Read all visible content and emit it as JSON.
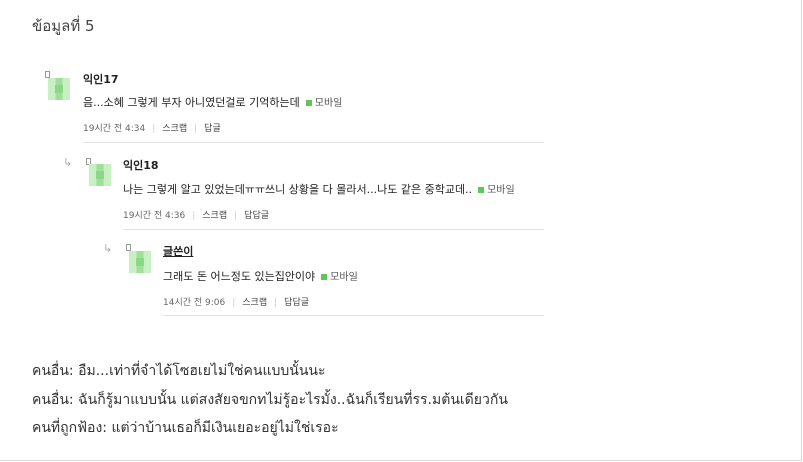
{
  "heading": "ข้อมูลที่ 5",
  "comments": [
    {
      "nick": "익인17",
      "text": "음...소혜 그렇게 부자 아니였던걸로 기억하는데",
      "device": "모바일",
      "time": "19시간 전 4:34",
      "scrap": "스크랩",
      "reply": "답글"
    },
    {
      "nick": "익인18",
      "text": "나는 그렇게 알고 있었는데ㅠㅠ쓰니 상황을 다 몰라서...나도 같은 중학교데..",
      "device": "모바일",
      "time": "19시간 전 4:36",
      "scrap": "스크랩",
      "reply": "답답글"
    },
    {
      "nick": "글쓴이",
      "text": "그래도 돈 어느정도 있는집안이야",
      "device": "모바일",
      "time": "14시간 전 9:06",
      "scrap": "스크랩",
      "reply": "답답글"
    }
  ],
  "narration": [
    "คนอื่น:  อืม...เท่าที่จำได้โซฮเยไม่ใช่คนแบบนั้นนะ",
    "คนอื่น:  ฉันก็รู้มาแบบนั้น แต่สงสัยจขกทไม่รู้อะไรมั้ง..ฉันก็เรียนที่รร.มต้นเดียวกัน",
    "คนที่ถูกฟ้อง:  แต่ว่าบ้านเธอก็มีเงินเยอะอยู่ไม่ใช่เรอะ"
  ]
}
